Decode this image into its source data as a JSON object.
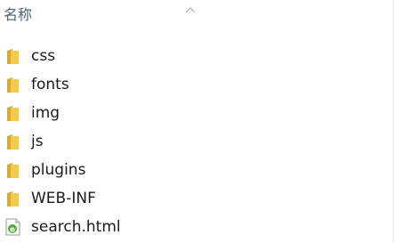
{
  "header": {
    "name_column": "名称"
  },
  "files": [
    {
      "name": "css",
      "icon": "folder-icon"
    },
    {
      "name": "fonts",
      "icon": "folder-icon"
    },
    {
      "name": "img",
      "icon": "folder-icon"
    },
    {
      "name": "js",
      "icon": "folder-icon"
    },
    {
      "name": "plugins",
      "icon": "folder-icon"
    },
    {
      "name": "WEB-INF",
      "icon": "folder-icon"
    },
    {
      "name": "search.html",
      "icon": "html-file-icon"
    }
  ],
  "colors": {
    "folder": "#f2c94c",
    "folder_dark": "#dcaa2a",
    "header_text": "#4c607a",
    "html_icon_green": "#4caf3a"
  }
}
